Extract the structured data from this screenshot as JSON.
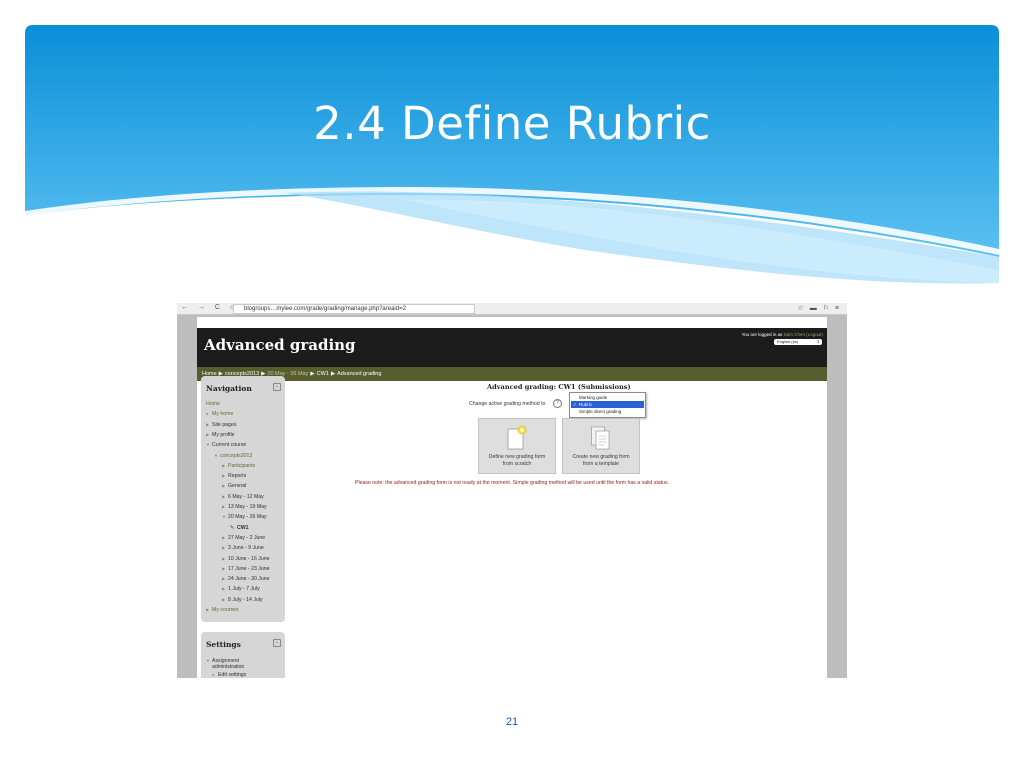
{
  "slide": {
    "title": "2.4 Define Rubric",
    "page_number": "21",
    "accent_colors": {
      "header_top": "#0a8fd8",
      "header_bottom": "#5cc1f2",
      "wave_light": "#bfe6fa"
    }
  },
  "browser": {
    "nav_glyphs": "← → C ⌂",
    "url": "blogroups…mylee.com/grade/grading/manage.php?areaid=2",
    "icons": "☆ ▬ ⚐ ≡"
  },
  "moodle": {
    "site_name": "Advanced grading",
    "login": {
      "prefix": "You are logged in as",
      "user": "Sam Chen",
      "logout": "(Logout)"
    },
    "language": "English (en)",
    "breadcrumb": [
      "Home",
      "concepts2013",
      "20 May - 26 May",
      "CW1",
      "Advanced grading"
    ],
    "navigation": {
      "title": "Navigation",
      "toggle": "−",
      "items": [
        {
          "label": "Home",
          "mark": "",
          "indent": 0,
          "link": true
        },
        {
          "label": "My home",
          "mark": "●",
          "indent": 0,
          "link": true
        },
        {
          "label": "Site pages",
          "mark": "▶",
          "indent": 0,
          "link": false
        },
        {
          "label": "My profile",
          "mark": "▶",
          "indent": 0,
          "link": false
        },
        {
          "label": "Current course",
          "mark": "▼",
          "indent": 0,
          "link": false
        },
        {
          "label": "concepts2013",
          "mark": "▼",
          "indent": 1,
          "link": true
        },
        {
          "label": "Participants",
          "mark": "▶",
          "indent": 2,
          "link": true
        },
        {
          "label": "Reports",
          "mark": "▶",
          "indent": 2,
          "link": false
        },
        {
          "label": "General",
          "mark": "▶",
          "indent": 2,
          "link": false
        },
        {
          "label": "6 May - 12 May",
          "mark": "▶",
          "indent": 2,
          "link": false
        },
        {
          "label": "13 May - 19 May",
          "mark": "▶",
          "indent": 2,
          "link": false
        },
        {
          "label": "20 May - 26 May",
          "mark": "▼",
          "indent": 2,
          "link": false
        },
        {
          "label": "CW1",
          "mark": "icon",
          "indent": 3,
          "link": false,
          "current": true
        },
        {
          "label": "27 May - 2 June",
          "mark": "▶",
          "indent": 2,
          "link": false
        },
        {
          "label": "3 June - 9 June",
          "mark": "▶",
          "indent": 2,
          "link": false
        },
        {
          "label": "10 June - 16 June",
          "mark": "▶",
          "indent": 2,
          "link": false
        },
        {
          "label": "17 June - 23 June",
          "mark": "▶",
          "indent": 2,
          "link": false
        },
        {
          "label": "24 June - 30 June",
          "mark": "▶",
          "indent": 2,
          "link": false
        },
        {
          "label": "1 July - 7 July",
          "mark": "▶",
          "indent": 2,
          "link": false
        },
        {
          "label": "8 July - 14 July",
          "mark": "▶",
          "indent": 2,
          "link": false
        },
        {
          "label": "My courses",
          "mark": "▶",
          "indent": 0,
          "link": true
        }
      ]
    },
    "settings": {
      "title": "Settings",
      "toggle": "−",
      "items": [
        {
          "label": "Assignment",
          "mark": "▼"
        },
        {
          "label": "administration",
          "mark": ""
        },
        {
          "label": "Edit settings",
          "mark": "●"
        }
      ]
    },
    "main": {
      "title": "Advanced grading: CW1 (Submissions)",
      "change_label": "Change active grading method to",
      "help": "?",
      "methods": [
        {
          "label": "Marking guide",
          "selected": false
        },
        {
          "label": "Rubric",
          "selected": true
        },
        {
          "label": "Simple direct grading",
          "selected": false
        }
      ],
      "tiles": [
        {
          "line1": "Define new grading form",
          "line2": "from scratch"
        },
        {
          "line1": "Create new grading form",
          "line2": "from a template"
        }
      ],
      "note": "Please note: the advanced grading form is not ready at the moment. Simple grading method will be used until the form has a valid status."
    }
  }
}
